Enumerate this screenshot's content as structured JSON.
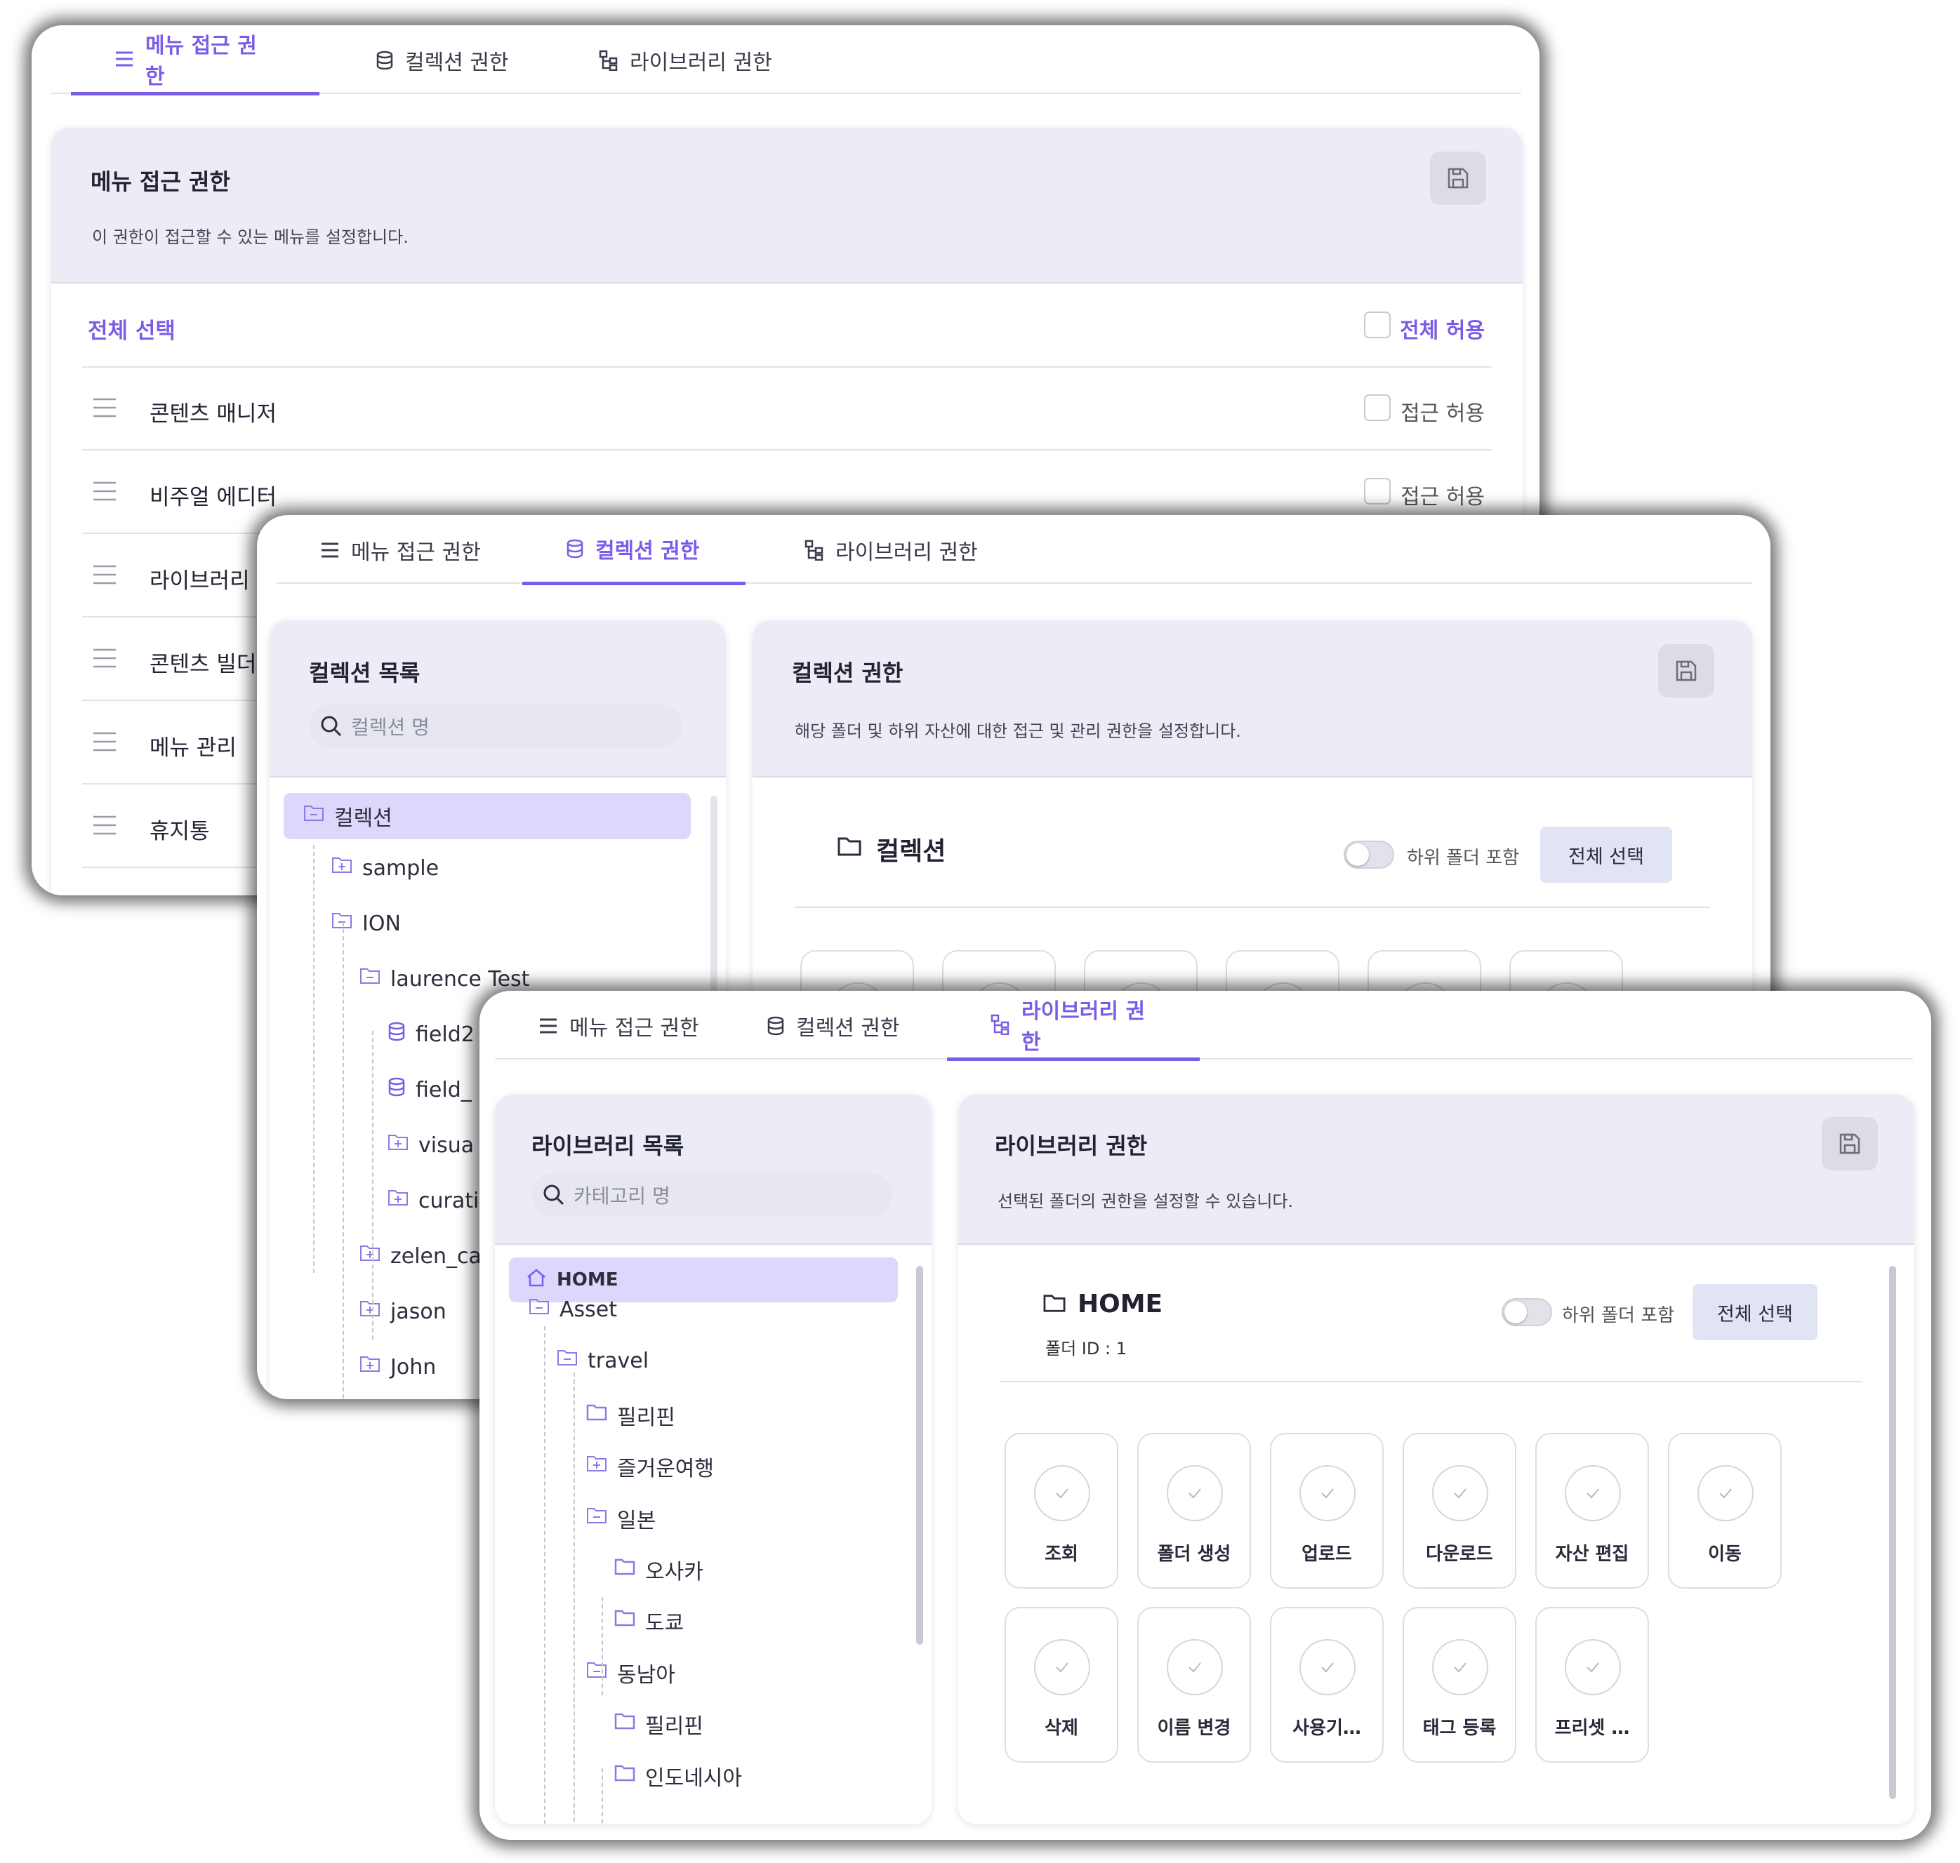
{
  "tabs": {
    "menu": "메뉴 접근 권한",
    "collection": "컬렉션 권한",
    "library": "라이브러리 권한"
  },
  "menu_panel": {
    "title": "메뉴 접근 권한",
    "description": "이 권한이 접근할 수 있는 메뉴를 설정합니다.",
    "select_all": "전체 선택",
    "allow_all": "전체 허용",
    "allow_label": "접근 허용",
    "items": [
      "콘텐츠 매니저",
      "비주얼 에디터",
      "라이브러리",
      "콘텐츠 빌더",
      "메뉴 관리",
      "휴지통"
    ]
  },
  "collection_panel": {
    "list_title": "컬렉션 목록",
    "search_placeholder": "컬렉션 명",
    "tree": [
      {
        "label": "컬렉션",
        "icon": "folder-minus-icon",
        "selected": true
      },
      {
        "label": "sample",
        "icon": "folder-plus-icon"
      },
      {
        "label": "ION",
        "icon": "folder-minus-icon"
      },
      {
        "label": "laurence Test",
        "icon": "folder-minus-icon"
      },
      {
        "label": "field2",
        "icon": "database-icon"
      },
      {
        "label": "field_",
        "icon": "database-icon"
      },
      {
        "label": "visua",
        "icon": "folder-plus-icon"
      },
      {
        "label": "curati",
        "icon": "folder-plus-icon"
      },
      {
        "label": "zelen_ca",
        "icon": "folder-plus-icon"
      },
      {
        "label": "jason",
        "icon": "folder-plus-icon"
      },
      {
        "label": "John",
        "icon": "folder-plus-icon"
      }
    ],
    "title": "컬렉션 권한",
    "description": "해당 폴더 및 하위 자산에 대한 접근 및 관리 권한을 설정합니다.",
    "folder_name": "컬렉션",
    "include_sub": "하위 폴더 포함",
    "select_all": "전체 선택"
  },
  "library_panel": {
    "list_title": "라이브러리 목록",
    "search_placeholder": "카테고리 명",
    "tree": [
      {
        "label": "HOME",
        "icon": "home-icon",
        "selected": true
      },
      {
        "label": "Asset",
        "icon": "folder-minus-icon"
      },
      {
        "label": "travel",
        "icon": "folder-minus-icon"
      },
      {
        "label": "필리핀",
        "icon": "folder-icon"
      },
      {
        "label": "즐거운여행",
        "icon": "folder-plus-icon"
      },
      {
        "label": "일본",
        "icon": "folder-minus-icon"
      },
      {
        "label": "오사카",
        "icon": "folder-icon"
      },
      {
        "label": "도쿄",
        "icon": "folder-icon"
      },
      {
        "label": "동남아",
        "icon": "folder-minus-icon"
      },
      {
        "label": "필리핀",
        "icon": "folder-icon"
      },
      {
        "label": "인도네시아",
        "icon": "folder-icon"
      }
    ],
    "title": "라이브러리 권한",
    "description": "선택된 폴더의 권한을 설정할 수 있습니다.",
    "folder_name": "HOME",
    "folder_id": "폴더 ID : 1",
    "include_sub": "하위 폴더 포함",
    "select_all": "전체 선택",
    "permissions": [
      "조회",
      "폴더 생성",
      "업로드",
      "다운로드",
      "자산 편집",
      "이동",
      "삭제",
      "이름 변경",
      "사용기…",
      "태그 등록",
      "프리셋 …"
    ]
  },
  "colors": {
    "accent": "#7b5ce8",
    "header_bg": "#ebecf5",
    "selected_bg": "#ddd8fb"
  }
}
